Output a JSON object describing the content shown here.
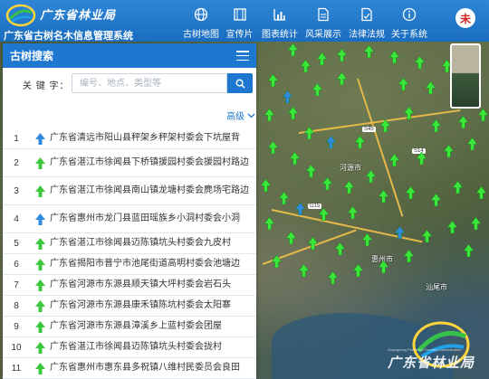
{
  "header": {
    "logo_text": "广东省林业局",
    "system_title": "广东省古树名木信息管理系统",
    "nav": [
      {
        "label": "古树地图",
        "icon": "globe-icon"
      },
      {
        "label": "宣传片",
        "icon": "film-icon"
      },
      {
        "label": "图表统计",
        "icon": "bar-chart-icon"
      },
      {
        "label": "风采展示",
        "icon": "document-icon"
      },
      {
        "label": "法律法规",
        "icon": "law-document-icon"
      },
      {
        "label": "关于系统",
        "icon": "info-icon"
      }
    ],
    "avatar_text": "未"
  },
  "panel": {
    "title": "古树搜索",
    "keyword_label": "关 键 字：",
    "keyword_placeholder": "编号、地点、类型等",
    "keyword_value": "",
    "advanced_label": "高级",
    "results": [
      {
        "index": "1",
        "text": "广东省清远市阳山县秤架乡秤架村委会下坑屋背",
        "color": "#2f8be0"
      },
      {
        "index": "2",
        "text": "广东省湛江市徐闻县下桥镇援园村委会援园村路边",
        "color": "#3cc83c"
      },
      {
        "index": "3",
        "text": "广东省湛江市徐闻县南山镇龙塘村委会麂场宅路边",
        "color": "#3cc83c"
      },
      {
        "index": "4",
        "text": "广东省惠州市龙门县蓝田瑶族乡小洞村委会小洞",
        "color": "#2f8be0"
      },
      {
        "index": "5",
        "text": "广东省湛江市徐闻县迈陈镇坑头村委会九皮村",
        "color": "#3cc83c"
      },
      {
        "index": "6",
        "text": "广东省揭阳市普宁市池尾街道高明村委会池塘边",
        "color": "#3cc83c"
      },
      {
        "index": "7",
        "text": "广东省河源市东源县顺天镇大坪村委会岩石头",
        "color": "#3cc83c"
      },
      {
        "index": "8",
        "text": "广东省河源市东源县康禾镇陈坑村委会太阳寨",
        "color": "#3cc83c"
      },
      {
        "index": "9",
        "text": "广东省河源市东源县漳溪乡上蓝村委会团屋",
        "color": "#3cc83c"
      },
      {
        "index": "10",
        "text": "广东省湛江市徐闻县迈陈镇坑头村委会拢村",
        "color": "#3cc83c"
      },
      {
        "index": "11",
        "text": "广东省惠州市惠东县多祝镇八维村民委员会良田",
        "color": "#3cc83c"
      }
    ]
  },
  "map": {
    "places": [
      "惠州市",
      "河源市",
      "汕尾市"
    ],
    "roads": [
      "S45",
      "G15",
      "S14"
    ],
    "watermark_text": "广东省林业局",
    "watermark_subtext": "Guangdong Provincial Forestry Administration"
  }
}
